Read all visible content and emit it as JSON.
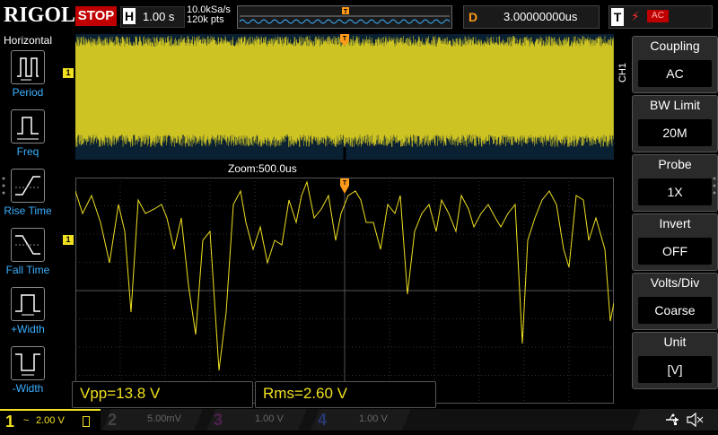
{
  "topbar": {
    "brand": "RIGOL",
    "run_state": "STOP",
    "horizontal_key": "H",
    "horizontal_scale": "1.00 s",
    "sample_rate": "10.0kSa/s",
    "memory_depth": "120k pts",
    "delay_key": "D",
    "delay_value": "3.00000000us",
    "trigger_key": "T",
    "trigger_source": "AC"
  },
  "left_panel": {
    "title": "Horizontal",
    "items": [
      {
        "label": "Period",
        "icon": "period-icon"
      },
      {
        "label": "Freq",
        "icon": "frequency-icon"
      },
      {
        "label": "Rise Time",
        "icon": "rise-time-icon"
      },
      {
        "label": "Fall Time",
        "icon": "fall-time-icon"
      },
      {
        "label": "+Width",
        "icon": "positive-width-icon"
      },
      {
        "label": "-Width",
        "icon": "negative-width-icon"
      }
    ]
  },
  "right_panel": {
    "channel_tab": "CH1",
    "items": [
      {
        "title": "Coupling",
        "value": "AC"
      },
      {
        "title": "BW Limit",
        "value": "20M"
      },
      {
        "title": "Probe",
        "value": "1X"
      },
      {
        "title": "Invert",
        "value": "OFF"
      },
      {
        "title": "Volts/Div",
        "value": "Coarse"
      },
      {
        "title": "Unit",
        "value": "[V]"
      }
    ]
  },
  "display": {
    "zoom_label": "Zoom:500.0us",
    "channel_marker": "1",
    "trigger_marker": "T"
  },
  "measurements": {
    "vpp": "Vpp=13.8 V",
    "rms": "Rms=2.60 V"
  },
  "bottom_bar": {
    "channels": [
      {
        "num": "1",
        "scale": "2.00 V",
        "coupling_symbol": "~",
        "color": "#f0e020",
        "active": true
      },
      {
        "num": "2",
        "scale": "5.00mV",
        "color": "#1fb8e0",
        "active": false
      },
      {
        "num": "3",
        "scale": "1.00 V",
        "color": "#e030e0",
        "active": false
      },
      {
        "num": "4",
        "scale": "1.00 V",
        "color": "#3070ff",
        "active": false
      }
    ]
  },
  "colors": {
    "ch1": "#f0e020",
    "accent": "#3ab0ff",
    "trigger": "#ff9a1a",
    "stop": "#c00000"
  },
  "icons": [
    "usb-icon",
    "speaker-muted-icon"
  ]
}
